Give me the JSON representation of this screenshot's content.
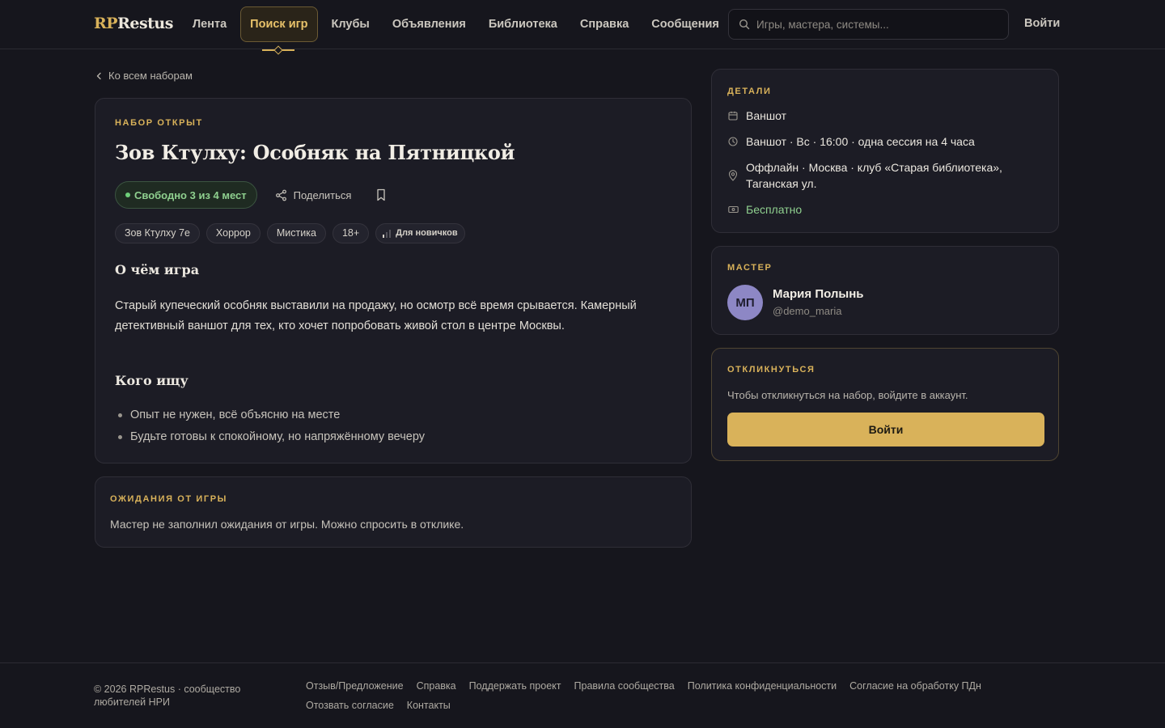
{
  "header": {
    "logo_rp": "RP",
    "logo_rest": "Restus",
    "nav": [
      "Лента",
      "Поиск игр",
      "Клубы",
      "Объявления",
      "Библиотека",
      "Справка",
      "Сообщения"
    ],
    "active_nav": "Поиск игр",
    "search_placeholder": "Игры, мастера, системы...",
    "login": "Войти"
  },
  "back_link": "Ко всем наборам",
  "game": {
    "status": "НАБОР ОТКРЫТ",
    "title": "Зов Ктулху: Особняк на Пятницкой",
    "free_slots": "Свободно 3 из 4 мест",
    "share": "Поделиться",
    "tags": [
      "Зов Ктулху 7е",
      "Хоррор",
      "Мистика",
      "18+"
    ],
    "level_tag": "Для новичков",
    "about_heading": "О чём игра",
    "about_text": "Старый купеческий особняк выставили на продажу, но осмотр всё время срывается. Камерный детективный ваншот для тех, кто хочет попробовать живой стол в центре Москвы.",
    "seeking_heading": "Кого ищу",
    "seeking": [
      "Опыт не нужен, всё объясню на месте",
      "Будьте готовы к спокойному, но напряжённому вечеру"
    ]
  },
  "expectations": {
    "heading": "ОЖИДАНИЯ ОТ ИГРЫ",
    "text": "Мастер не заполнил ожидания от игры. Можно спросить в отклике."
  },
  "details": {
    "heading": "ДЕТАЛИ",
    "format": "Ваншот",
    "schedule": "Ваншот · Вс · 16:00 · одна сессия на 4 часа",
    "location": "Оффлайн · Москва · клуб «Старая библиотека», Таганская ул.",
    "price": "Бесплатно"
  },
  "master": {
    "heading": "МАСТЕР",
    "initials": "МП",
    "name": "Мария Полынь",
    "handle": "@demo_maria"
  },
  "respond": {
    "heading": "ОТКЛИКНУТЬСЯ",
    "text": "Чтобы откликнуться на набор, войдите в аккаунт.",
    "button": "Войти"
  },
  "footer": {
    "copyright": "© 2026 RPRestus · сообщество любителей НРИ",
    "links": [
      "Отзыв/Предложение",
      "Справка",
      "Поддержать проект",
      "Правила сообщества",
      "Политика конфиденциальности",
      "Согласие на обработку ПДн",
      "Отозвать согласие",
      "Контакты"
    ]
  },
  "colors": {
    "accent": "#d9b25a",
    "background": "#16161d",
    "card": "#1c1c25",
    "success": "#8fd08f"
  }
}
